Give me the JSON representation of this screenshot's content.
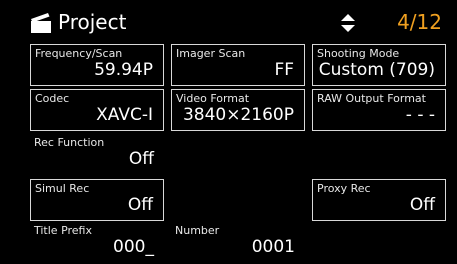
{
  "header": {
    "title": "Project",
    "icon": "clapperboard-icon",
    "nav_icon": "up-down-arrows-icon",
    "page": "4/12",
    "page_color": "#f0a020"
  },
  "settings": {
    "frequency_scan": {
      "label": "Frequency/Scan",
      "value": "59.94P"
    },
    "imager_scan": {
      "label": "Imager Scan",
      "value": "FF"
    },
    "shooting_mode": {
      "label": "Shooting Mode",
      "value": "Custom (709)"
    },
    "codec": {
      "label": "Codec",
      "value": "XAVC-I"
    },
    "video_format": {
      "label": "Video Format",
      "value": "3840×2160P"
    },
    "raw_output_format": {
      "label": "RAW Output Format",
      "value": "- - -"
    },
    "rec_function": {
      "label": "Rec Function",
      "value": "Off"
    },
    "simul_rec": {
      "label": "Simul Rec",
      "value": "Off"
    },
    "proxy_rec": {
      "label": "Proxy Rec",
      "value": "Off"
    },
    "title_prefix": {
      "label": "Title Prefix",
      "value": "000_"
    },
    "number": {
      "label": "Number",
      "value": "0001"
    }
  }
}
